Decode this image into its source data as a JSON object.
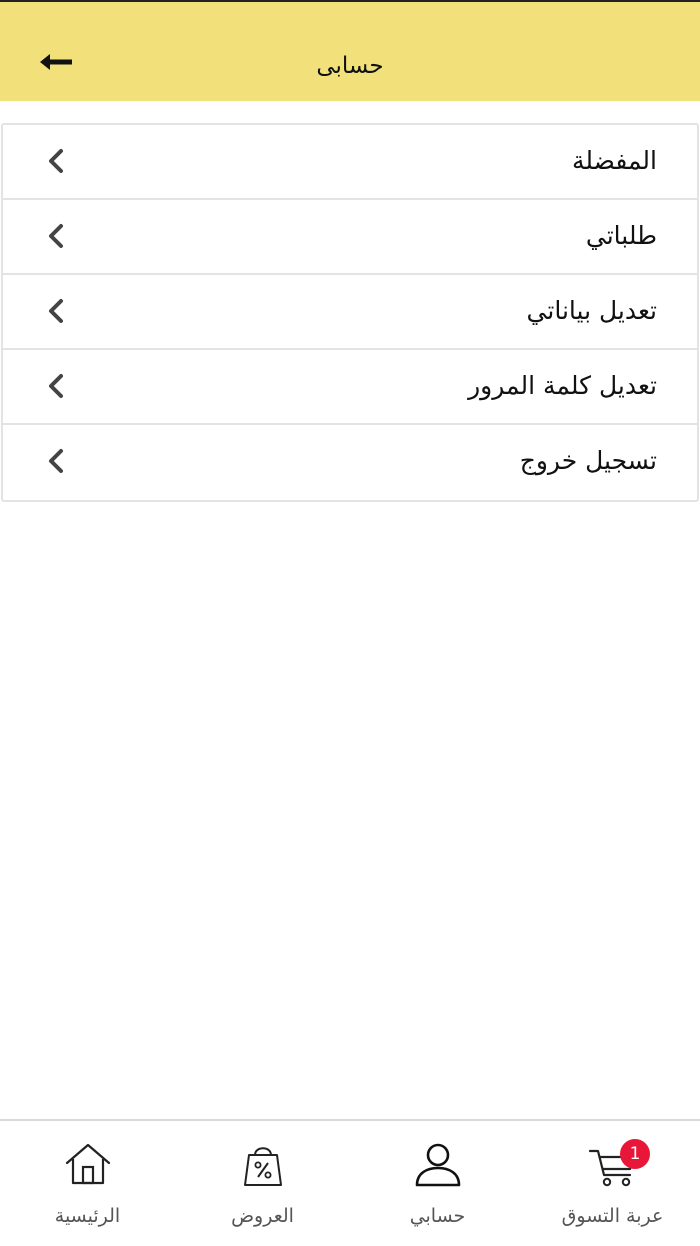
{
  "header": {
    "title": "حسابى",
    "back_icon": "arrow-left-icon"
  },
  "menu": [
    {
      "label": "المفضلة",
      "icon": "chevron-left-icon"
    },
    {
      "label": "طلباتي",
      "icon": "chevron-left-icon"
    },
    {
      "label": "تعديل بياناتي",
      "icon": "chevron-left-icon"
    },
    {
      "label": "تعديل كلمة المرور",
      "icon": "chevron-left-icon"
    },
    {
      "label": "تسجيل خروج",
      "icon": "chevron-left-icon"
    }
  ],
  "tabbar": {
    "home": {
      "label": "الرئيسية",
      "icon": "home-icon"
    },
    "offers": {
      "label": "العروض",
      "icon": "shopping-bag-percent-icon"
    },
    "account": {
      "label": "حسابي",
      "icon": "user-icon"
    },
    "cart": {
      "label": "عربة التسوق",
      "icon": "cart-icon",
      "badge": "1"
    }
  },
  "colors": {
    "header_bg": "#f2e17a",
    "badge": "#e8173a"
  }
}
